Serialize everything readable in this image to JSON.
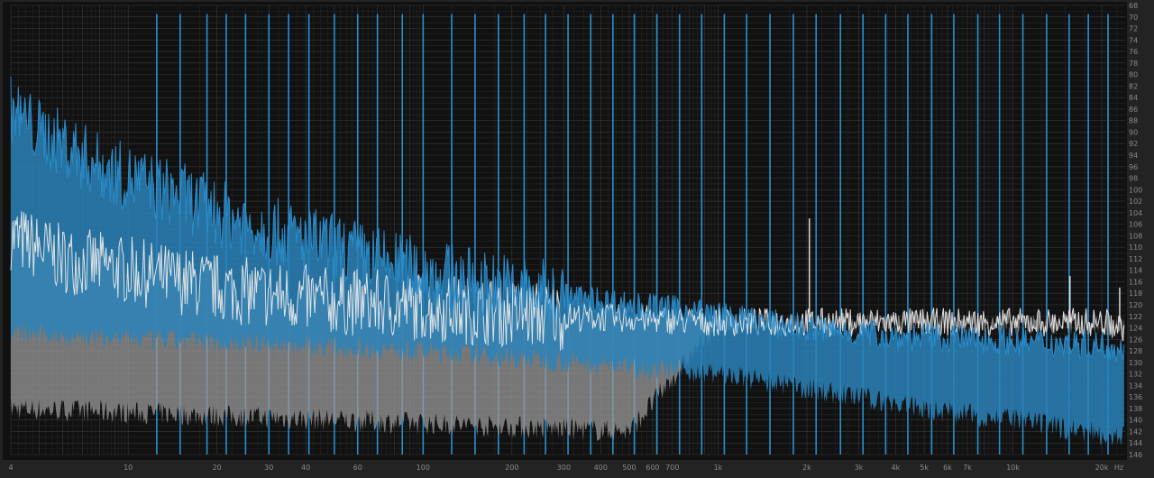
{
  "chart_data": {
    "type": "line",
    "x_scale": "log",
    "x_range_hz": [
      4,
      24000
    ],
    "y_range_db": [
      -68,
      -146
    ],
    "grid": true,
    "x_ticks": [
      {
        "hz": 4,
        "label": "4"
      },
      {
        "hz": 10,
        "label": "10"
      },
      {
        "hz": 20,
        "label": "20"
      },
      {
        "hz": 30,
        "label": "30"
      },
      {
        "hz": 40,
        "label": "40"
      },
      {
        "hz": 60,
        "label": "60"
      },
      {
        "hz": 100,
        "label": "100"
      },
      {
        "hz": 200,
        "label": "200"
      },
      {
        "hz": 300,
        "label": "300"
      },
      {
        "hz": 400,
        "label": "400"
      },
      {
        "hz": 500,
        "label": "500"
      },
      {
        "hz": 600,
        "label": "600"
      },
      {
        "hz": 700,
        "label": "700"
      },
      {
        "hz": 1000,
        "label": "1k"
      },
      {
        "hz": 2000,
        "label": "2k"
      },
      {
        "hz": 3000,
        "label": "3k"
      },
      {
        "hz": 4000,
        "label": "4k"
      },
      {
        "hz": 5000,
        "label": "5k"
      },
      {
        "hz": 6000,
        "label": "6k"
      },
      {
        "hz": 7000,
        "label": "7k"
      },
      {
        "hz": 10000,
        "label": "10k"
      },
      {
        "hz": 20000,
        "label": "20k"
      }
    ],
    "x_unit": "Hz",
    "y_ticks": [
      "68",
      "70",
      "72",
      "74",
      "76",
      "78",
      "80",
      "82",
      "84",
      "86",
      "88",
      "90",
      "92",
      "94",
      "96",
      "98",
      "100",
      "102",
      "104",
      "106",
      "108",
      "110",
      "112",
      "114",
      "116",
      "118",
      "120",
      "122",
      "124",
      "126",
      "128",
      "130",
      "132",
      "134",
      "136",
      "138",
      "140",
      "142",
      "144",
      "146"
    ],
    "harmonic_lines_hz": [
      12.5,
      15,
      18.5,
      21.5,
      25,
      30,
      35,
      41,
      50,
      60,
      70,
      85,
      100,
      125,
      150,
      180,
      220,
      260,
      310,
      370,
      440,
      520,
      620,
      740,
      880,
      1050,
      1250,
      1500,
      1800,
      2150,
      2600,
      3100,
      3700,
      4400,
      5300,
      6300,
      7600,
      9000,
      10800,
      13000,
      15500,
      18000,
      21000
    ],
    "series": [
      {
        "color": "#2a8fd0",
        "points": [
          [
            4,
            -86
          ],
          [
            5,
            -90
          ],
          [
            6,
            -92
          ],
          [
            8,
            -96
          ],
          [
            10,
            -98
          ],
          [
            15,
            -101
          ],
          [
            20,
            -104
          ],
          [
            30,
            -107
          ],
          [
            50,
            -110
          ],
          [
            80,
            -113
          ],
          [
            120,
            -115
          ],
          [
            200,
            -117
          ],
          [
            300,
            -118.5
          ],
          [
            500,
            -120
          ],
          [
            800,
            -121
          ],
          [
            1000,
            -122
          ],
          [
            2000,
            -124
          ],
          [
            4000,
            -125.5
          ],
          [
            8000,
            -126
          ],
          [
            12000,
            -126.5
          ],
          [
            20000,
            -127
          ],
          [
            24000,
            -127.5
          ]
        ],
        "floor": [
          [
            4,
            -125
          ],
          [
            100,
            -128
          ],
          [
            1000,
            -132
          ],
          [
            5000,
            -138
          ],
          [
            10000,
            -140
          ],
          [
            24000,
            -143
          ]
        ]
      },
      {
        "color": "#e8e8e8",
        "points": [
          [
            4,
            -108
          ],
          [
            6,
            -112
          ],
          [
            10,
            -114
          ],
          [
            20,
            -117
          ],
          [
            40,
            -119
          ],
          [
            80,
            -120
          ],
          [
            150,
            -121
          ],
          [
            300,
            -122
          ],
          [
            600,
            -122.5
          ],
          [
            1000,
            -123
          ],
          [
            3000,
            -123
          ],
          [
            10000,
            -123
          ],
          [
            20000,
            -123
          ],
          [
            24000,
            -124
          ]
        ],
        "floor": [
          [
            4,
            -138
          ],
          [
            50,
            -140
          ],
          [
            500,
            -142
          ],
          [
            1000,
            -123
          ],
          [
            24000,
            -123.5
          ]
        ]
      }
    ],
    "spikes": [
      {
        "hz": 2040,
        "db": -105,
        "color": "#e8e8e8"
      },
      {
        "hz": 15600,
        "db": -115,
        "color": "#e8e8e8"
      },
      {
        "hz": 23000,
        "db": -117,
        "color": "#e8e8e8"
      }
    ],
    "colors": {
      "background": "#1e1e1e",
      "plot": "#111111",
      "grid_minor": "#262626",
      "grid_major": "#3a3a3a",
      "harmonic": "#2a8fd0",
      "blue_fill": "#2a82b8",
      "white_fill": "#9a9a9a"
    }
  }
}
